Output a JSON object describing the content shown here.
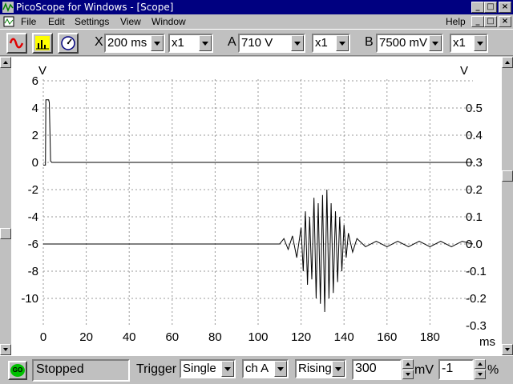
{
  "window": {
    "title": "PicoScope for Windows - [Scope]",
    "min_glyph": "_",
    "max_glyph": "□",
    "close_glyph": "×"
  },
  "menu": {
    "file": "File",
    "edit": "Edit",
    "settings": "Settings",
    "view": "View",
    "window": "Window",
    "help": "Help"
  },
  "toolbar": {
    "x_label": "X",
    "timebase": "200 ms",
    "x_mult": "x1",
    "a_label": "A",
    "a_range": "710 V",
    "a_mult": "x1",
    "b_label": "B",
    "b_range": "7500 mV",
    "b_mult": "x1"
  },
  "status": {
    "go_label": "GO",
    "state": "Stopped",
    "trigger_label": "Trigger",
    "trigger_mode": "Single",
    "trigger_channel": "ch A",
    "trigger_edge": "Rising",
    "trigger_level": "300",
    "level_unit": "mV",
    "pretrigger": "-1",
    "pretrigger_unit": "%"
  },
  "colors": {
    "title_bg": "#000080",
    "face": "#c0c0c0",
    "trace": "#000000",
    "go_led": "#00c000"
  },
  "chart_data": {
    "type": "line",
    "x_unit": "ms",
    "left_unit": "V",
    "right_unit": "V",
    "xlim": [
      0,
      200
    ],
    "left_ylim": [
      -12,
      6
    ],
    "right_ylim": [
      -0.3,
      0.6
    ],
    "x_ticks": [
      "0",
      "20",
      "40",
      "60",
      "80",
      "100",
      "120",
      "140",
      "160",
      "180"
    ],
    "left_ticks": [
      "6",
      "4",
      "2",
      "0",
      "-2",
      "-4",
      "-6",
      "-8",
      "-10"
    ],
    "right_ticks": [
      "0.5",
      "0.4",
      "0.3",
      "0.2",
      "0.1",
      "0.0",
      "-0.1",
      "-0.2",
      "-0.3"
    ],
    "grid": true,
    "series": [
      {
        "axis": "left",
        "x": [
          0,
          1,
          1.2,
          2.5,
          2.8,
          3.4,
          4,
          200
        ],
        "y": [
          -0.2,
          -0.2,
          4.6,
          4.6,
          4.4,
          0.1,
          0,
          0
        ]
      },
      {
        "axis": "right",
        "x": [
          0,
          110,
          112,
          114,
          116,
          118,
          120,
          121,
          122,
          123,
          124,
          125,
          126,
          127,
          128,
          129,
          130,
          131,
          132,
          133,
          134,
          135,
          136,
          137,
          138,
          139,
          140,
          141,
          142,
          144,
          146,
          150,
          155,
          160,
          165,
          170,
          175,
          180,
          185,
          190,
          195,
          200
        ],
        "y": [
          0,
          0,
          0.02,
          -0.02,
          0.03,
          -0.05,
          0.06,
          -0.1,
          0.12,
          -0.15,
          0.1,
          -0.13,
          0.17,
          -0.2,
          0.15,
          -0.22,
          0.18,
          -0.25,
          0.2,
          -0.2,
          0.15,
          -0.18,
          0.12,
          -0.14,
          0.1,
          -0.1,
          0.07,
          -0.05,
          0.04,
          -0.03,
          0.02,
          -0.01,
          0.01,
          -0.01,
          0.01,
          -0.01,
          0.01,
          -0.01,
          0.01,
          -0.01,
          0.01,
          0
        ]
      }
    ]
  }
}
